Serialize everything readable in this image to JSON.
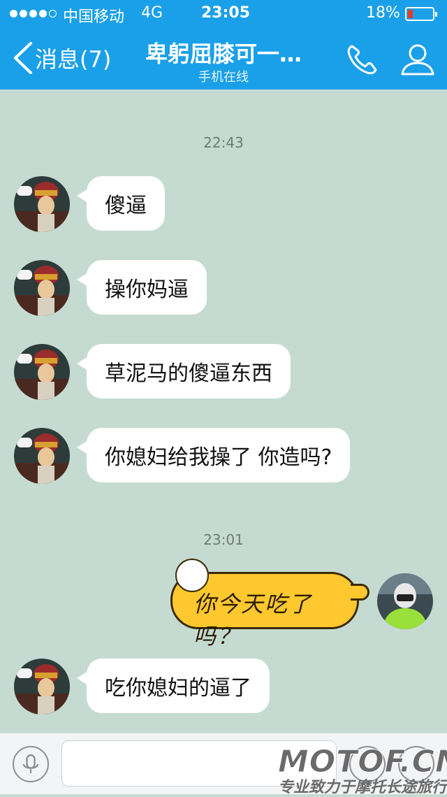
{
  "status_bar": {
    "carrier": "中国移动",
    "network": "4G",
    "time": "23:05",
    "battery": "18%",
    "battery_level": 0.18,
    "signal_bars": 5,
    "signal_filled": 4
  },
  "header": {
    "back_label": "消息(7)",
    "contact_name": "卑躬屈膝可一…",
    "presence": "手机在线",
    "phone_icon": "phone-icon",
    "profile_icon": "profile-icon"
  },
  "messages": {
    "ts1": "22:43",
    "ts2": "23:01",
    "m1": "傻逼",
    "m2": "操你妈逼",
    "m3": "草泥马的傻逼东西",
    "m4": "你媳妇给我操了 你造吗?",
    "sticker": "你今天吃了吗？",
    "m5": "吃你媳妇的逼了"
  },
  "input_bar": {
    "mic_icon": "microphone-icon",
    "text_value": "",
    "emoji_icon": "emoji-icon",
    "add_icon": "add-icon"
  },
  "watermark": {
    "logo": "MOTOF.CN",
    "tagline": "专业致力于摩托长途旅行"
  },
  "colors": {
    "header": "#1aa0e8",
    "chat_bg": "#c5dbd2",
    "bubble": "#ffffff",
    "sticker": "#ffc82e"
  }
}
